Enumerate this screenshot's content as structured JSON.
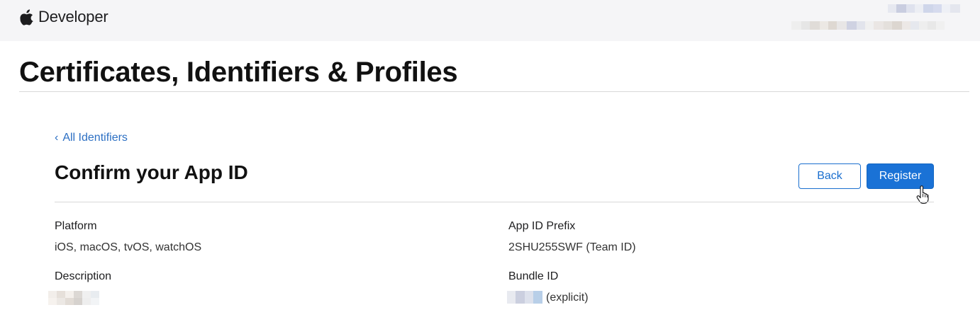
{
  "header": {
    "brand_label": "Developer",
    "logo_icon": "apple-logo-icon"
  },
  "page": {
    "title": "Certificates, Identifiers & Profiles"
  },
  "nav": {
    "back_link_label": "All Identifiers",
    "back_link_icon": "chevron-left-icon"
  },
  "section": {
    "title": "Confirm your App ID",
    "back_button_label": "Back",
    "register_button_label": "Register"
  },
  "details": {
    "platform_label": "Platform",
    "platform_value": "iOS, macOS, tvOS, watchOS",
    "description_label": "Description",
    "app_id_prefix_label": "App ID Prefix",
    "app_id_prefix_value": "2SHU255SWF (Team ID)",
    "bundle_id_label": "Bundle ID",
    "bundle_id_suffix": "(explicit)"
  },
  "colors": {
    "accent": "#1a72d6",
    "link": "#2c6fc3",
    "header_bg": "#f5f5f7"
  }
}
